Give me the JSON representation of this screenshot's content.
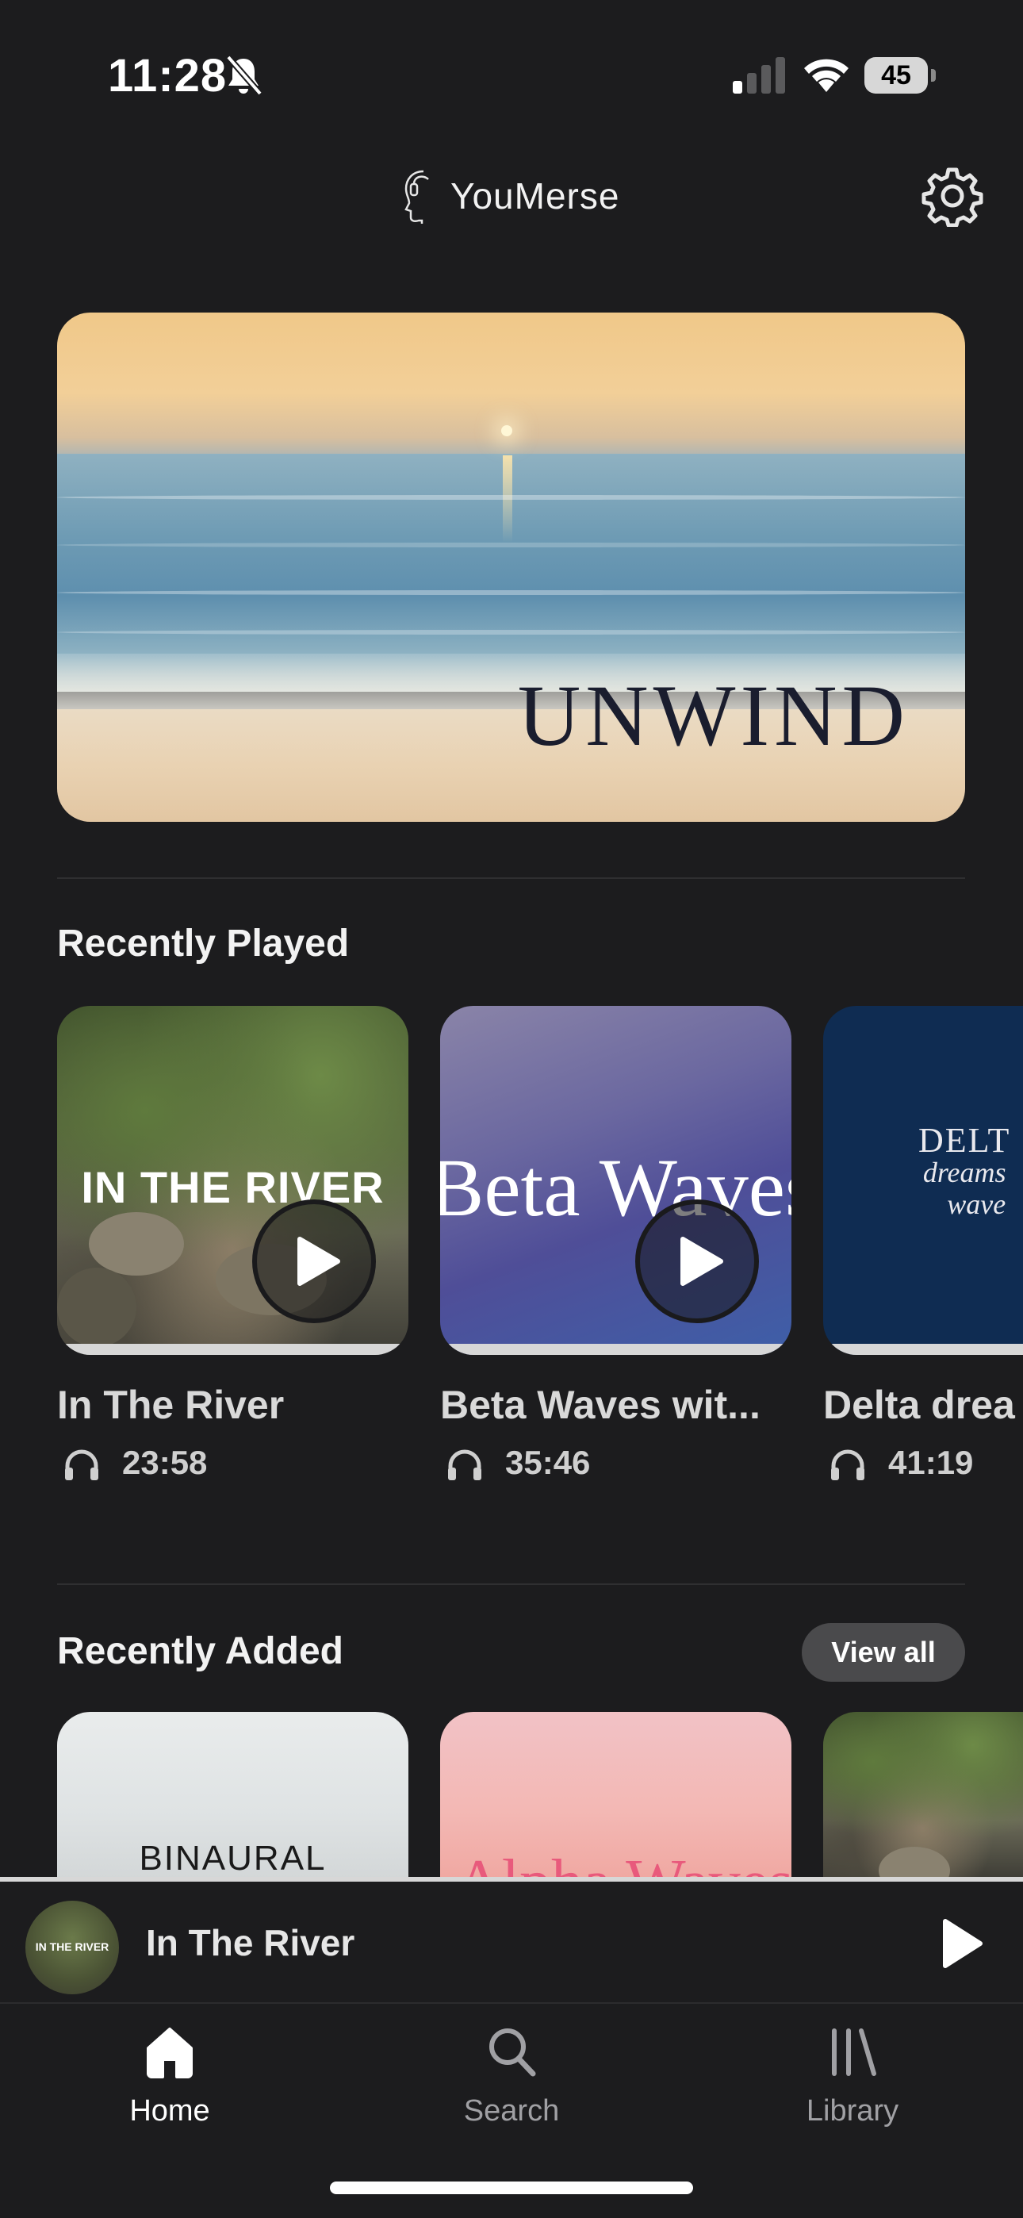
{
  "status_bar": {
    "time": "11:28",
    "battery": "45"
  },
  "header": {
    "app_title": "YouMerse"
  },
  "hero": {
    "word": "UNWIND"
  },
  "recently_played": {
    "title": "Recently Played",
    "items": [
      {
        "art_text": "IN THE RIVER",
        "title": "In The River",
        "duration": "23:58"
      },
      {
        "art_text": "Beta Waves",
        "title": "Beta Waves wit...",
        "duration": "35:46"
      },
      {
        "art_line1": "DELT",
        "art_line2": "dreams",
        "art_line3": "wave",
        "title": "Delta drea",
        "duration": "41:19"
      }
    ]
  },
  "recently_added": {
    "title": "Recently Added",
    "view_all": "View all",
    "items": [
      {
        "art_text": "BINAURAL"
      },
      {
        "art_text": "Alpha Waves"
      },
      {
        "art_text": ""
      }
    ]
  },
  "mini_player": {
    "thumb_text": "IN THE RIVER",
    "title": "In The River"
  },
  "tabs": [
    {
      "label": "Home",
      "icon": "home-icon",
      "active": true
    },
    {
      "label": "Search",
      "icon": "search-icon",
      "active": false
    },
    {
      "label": "Library",
      "icon": "library-icon",
      "active": false
    }
  ],
  "colors": {
    "background": "#1c1c1e",
    "active_tab": "#ffffff",
    "inactive_tab": "#a0a0a4"
  }
}
